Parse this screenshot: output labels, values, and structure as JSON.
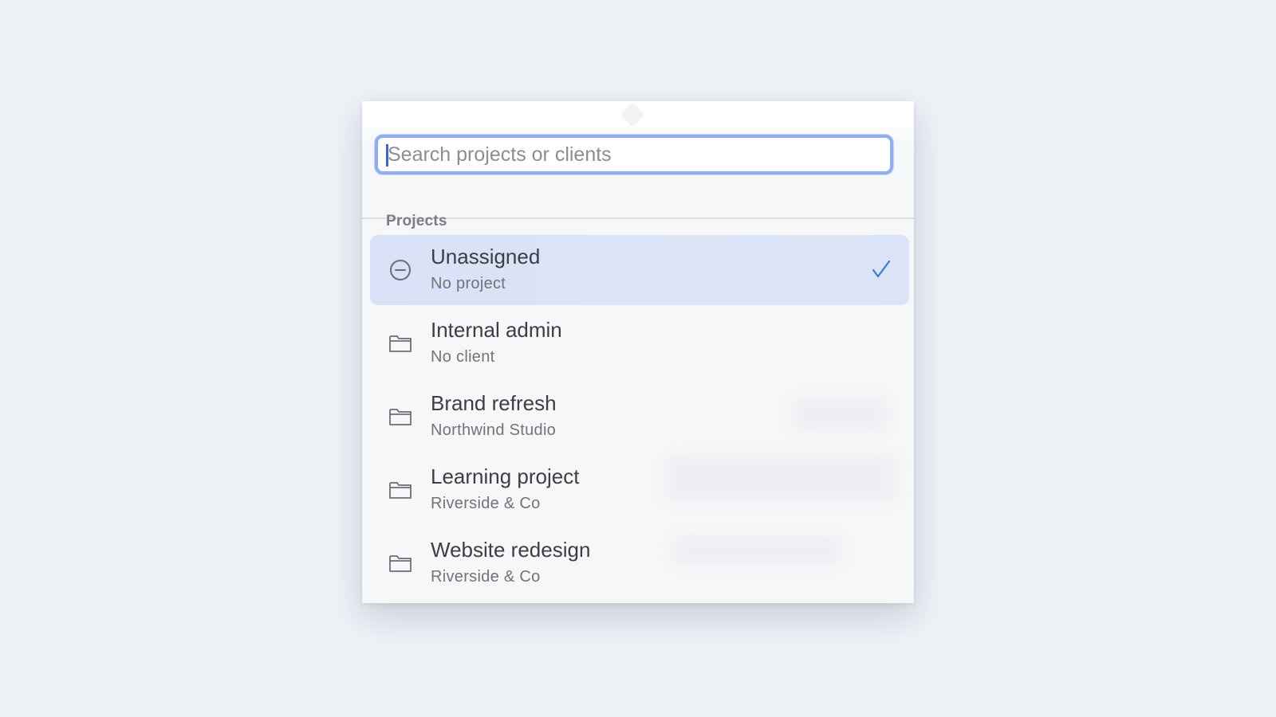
{
  "popover": {
    "search": {
      "placeholder": "Search projects or clients",
      "value": ""
    },
    "section_label": "Projects",
    "items": [
      {
        "title": "Unassigned",
        "subtitle": "No project",
        "icon": "minus-circle-icon",
        "selected": true
      },
      {
        "title": "Internal admin",
        "subtitle": "No client",
        "icon": "folder-icon",
        "selected": false
      },
      {
        "title": "Brand refresh",
        "subtitle": "Northwind Studio",
        "icon": "folder-icon",
        "selected": false
      },
      {
        "title": "Learning project",
        "subtitle": "Riverside & Co",
        "icon": "folder-icon",
        "selected": false
      },
      {
        "title": "Website redesign",
        "subtitle": "Riverside & Co",
        "icon": "folder-icon",
        "selected": false
      }
    ]
  },
  "colors": {
    "background": "#eef1f6",
    "accent": "#3a78e0",
    "selected_row": "#dbe3f6",
    "focus_ring": "#8fadf0"
  }
}
